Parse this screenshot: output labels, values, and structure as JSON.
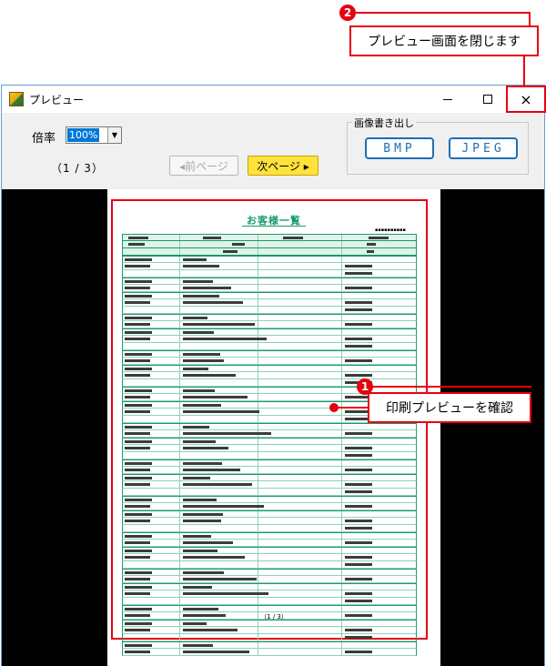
{
  "callouts": {
    "close": {
      "number": "2",
      "text": "プレビュー画面を閉じます"
    },
    "preview": {
      "number": "1",
      "text": "印刷プレビューを確認"
    }
  },
  "window": {
    "title": "プレビュー",
    "minimize_icon": "minimize-icon",
    "maximize_icon": "maximize-icon",
    "close_glyph": "×"
  },
  "toolbar": {
    "zoom_label": "倍率",
    "zoom_value": "100%",
    "page_counter": "（1 / 3）",
    "prev_label": "◂前ページ",
    "next_label": "次ページ ▸",
    "export_group_title": "画像書き出し",
    "bmp_label": "BMP",
    "jpeg_label": "JPEG"
  },
  "document": {
    "title": "お客様一覧",
    "pager": "（1 / 3）"
  },
  "colors": {
    "accent_red": "#e60012",
    "next_button": "#ffe23c",
    "export_blue": "#1d6fb8",
    "table_green": "#1a9a6a"
  }
}
